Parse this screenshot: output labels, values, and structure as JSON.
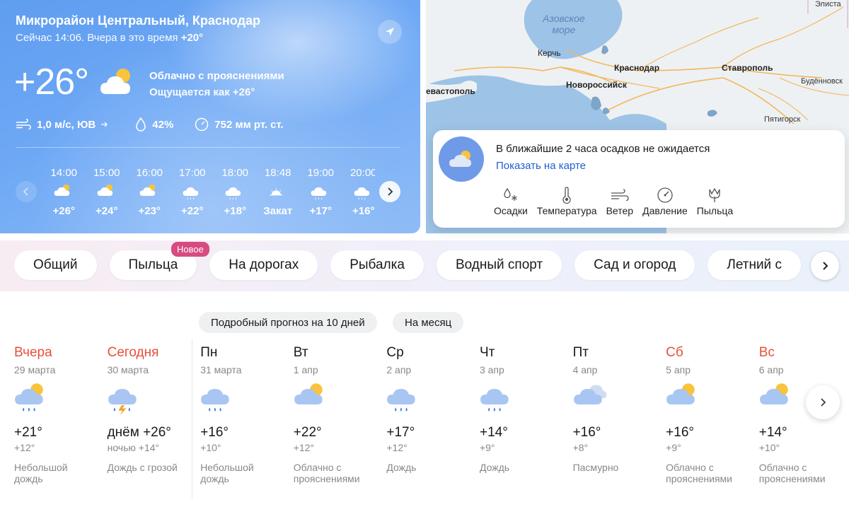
{
  "current": {
    "location": "Микрорайон Центральный, Краснодар",
    "now_prefix": "Сейчас 14:06. Вчера в это время",
    "yesterday_temp": "+20°",
    "temp": "+26°",
    "condition": "Облачно с прояснениями",
    "feels_like": "Ощущается как +26°",
    "wind": "1,0 м/с, ЮВ",
    "humidity": "42%",
    "pressure": "752 мм рт. ст."
  },
  "hourly": [
    {
      "time": "14:00",
      "temp": "+26°",
      "icon": "partly-cloudy-icon"
    },
    {
      "time": "15:00",
      "temp": "+24°",
      "icon": "partly-cloudy-icon"
    },
    {
      "time": "16:00",
      "temp": "+23°",
      "icon": "partly-cloudy-icon"
    },
    {
      "time": "17:00",
      "temp": "+22°",
      "icon": "cloud-rain-icon"
    },
    {
      "time": "18:00",
      "temp": "+18°",
      "icon": "cloud-rain-icon"
    },
    {
      "time": "18:48",
      "temp": "Закат",
      "icon": "sunset-icon"
    },
    {
      "time": "19:00",
      "temp": "+17°",
      "icon": "cloud-rain-icon"
    },
    {
      "time": "20:00",
      "temp": "+16°",
      "icon": "cloud-rain-icon"
    }
  ],
  "map": {
    "labels": {
      "sea": "Азовское море",
      "krasnodar": "Краснодар",
      "kerch": "Керчь",
      "novorossiysk": "Новороссийск",
      "stavropol": "Ставрополь",
      "sevastopol": "евастополь",
      "budennovsk": "Будённовск",
      "pyatigorsk": "Пятигорск",
      "elista": "Элиста"
    },
    "popup": {
      "message": "В ближайшие 2 часа осадков не ожидается",
      "link": "Показать на карте",
      "layers": [
        "Осадки",
        "Температура",
        "Ветер",
        "Давление",
        "Пыльца"
      ]
    }
  },
  "tabs": {
    "items": [
      "Общий",
      "Пыльца",
      "На дорогах",
      "Рыбалка",
      "Водный спорт",
      "Сад и огород",
      "Летний с"
    ],
    "badge": "Новое"
  },
  "forecast": {
    "title": "Прогноз на 10 дней",
    "detailed_button": "Подробный прогноз на 10 дней",
    "month_button": "На месяц",
    "days": [
      {
        "name": "Вчера",
        "date": "29 марта",
        "hi": "+21°",
        "lo": "+12°",
        "desc": "Небольшой дождь",
        "icon": "partly-cloudy-rain-icon",
        "weekend": true
      },
      {
        "name": "Сегодня",
        "date": "30 марта",
        "hi": "днём +26°",
        "lo": "ночью +14°",
        "desc": "Дождь с грозой",
        "icon": "thunderstorm-icon",
        "weekend": true
      },
      {
        "name": "Пн",
        "date": "31 марта",
        "hi": "+16°",
        "lo": "+10°",
        "desc": "Небольшой дождь",
        "icon": "cloud-rain-icon",
        "weekend": false
      },
      {
        "name": "Вт",
        "date": "1 апр",
        "hi": "+22°",
        "lo": "+12°",
        "desc": "Облачно с прояснениями",
        "icon": "partly-cloudy-icon",
        "weekend": false
      },
      {
        "name": "Ср",
        "date": "2 апр",
        "hi": "+17°",
        "lo": "+12°",
        "desc": "Дождь",
        "icon": "cloud-rain-icon",
        "weekend": false
      },
      {
        "name": "Чт",
        "date": "3 апр",
        "hi": "+14°",
        "lo": "+9°",
        "desc": "Дождь",
        "icon": "cloud-rain-icon",
        "weekend": false
      },
      {
        "name": "Пт",
        "date": "4 апр",
        "hi": "+16°",
        "lo": "+8°",
        "desc": "Пасмурно",
        "icon": "overcast-icon",
        "weekend": false
      },
      {
        "name": "Сб",
        "date": "5 апр",
        "hi": "+16°",
        "lo": "+9°",
        "desc": "Облачно с прояснениями",
        "icon": "partly-cloudy-icon",
        "weekend": true
      },
      {
        "name": "Вс",
        "date": "6 апр",
        "hi": "+14°",
        "lo": "+10°",
        "desc": "Облачно с прояснениями",
        "icon": "partly-cloudy-icon",
        "weekend": true
      }
    ]
  },
  "colors": {
    "weekend": "#e8503a",
    "link": "#1e5fd1",
    "badge": "#d84a82"
  }
}
